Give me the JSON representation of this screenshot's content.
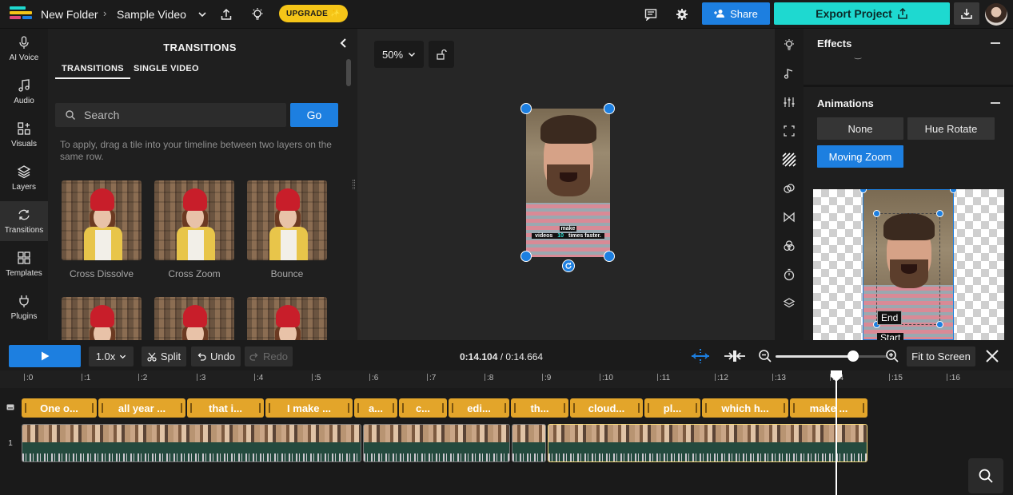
{
  "app": {
    "breadcrumb": [
      "New Folder",
      "Sample Video"
    ],
    "upgrade_label": "UPGRADE ✨",
    "share_label": "Share",
    "export_label": "Export Project",
    "accent": "#1d7fe0",
    "export_color": "#1ed9d0"
  },
  "rail": [
    {
      "label": "AI Voice",
      "icon": "mic-icon"
    },
    {
      "label": "Audio",
      "icon": "music-note-icon"
    },
    {
      "label": "Visuals",
      "icon": "grid-plus-icon"
    },
    {
      "label": "Layers",
      "icon": "layers-icon"
    },
    {
      "label": "Transitions",
      "icon": "transitions-icon",
      "active": true
    },
    {
      "label": "Templates",
      "icon": "templates-icon"
    },
    {
      "label": "Plugins",
      "icon": "plug-icon"
    }
  ],
  "transitions": {
    "title": "TRANSITIONS",
    "tabs": [
      "TRANSITIONS",
      "SINGLE VIDEO"
    ],
    "search_placeholder": "Search",
    "go_label": "Go",
    "hint": "To apply, drag a tile into your timeline between two layers on the same row.",
    "tiles": [
      "Cross Dissolve",
      "Cross Zoom",
      "Bounce",
      "",
      "",
      ""
    ]
  },
  "canvas": {
    "zoom": "50%",
    "caption_line1": "make",
    "caption_line2_pre": "videos ",
    "caption_highlight": "10",
    "caption_line2_post": " times faster."
  },
  "right_panel": {
    "effects_title": "Effects",
    "animations_title": "Animations",
    "animation_options": [
      "None",
      "Hue Rotate",
      "Moving Zoom"
    ],
    "selected_animation": "Moving Zoom",
    "end_label": "End",
    "start_label": "Start"
  },
  "transport": {
    "speed": "1.0x",
    "split_label": "Split",
    "undo_label": "Undo",
    "redo_label": "Redo",
    "current_time": "0:14.104",
    "total_time": "0:14.664",
    "fit_label": "Fit to Screen",
    "zoom_level_fraction": 0.69
  },
  "timeline": {
    "ruler_labels": [
      ":0",
      ":1",
      ":2",
      ":3",
      ":4",
      ":5",
      ":6",
      ":7",
      ":8",
      ":9",
      ":10",
      ":11",
      ":12",
      ":13",
      ":14",
      ":15",
      ":16"
    ],
    "row_1_label": "1",
    "subtitle_clips": [
      "One o...",
      "all year ...",
      "that i...",
      "I make ...",
      "a...",
      "c...",
      "edi...",
      "th...",
      "cloud...",
      "pl...",
      "which h...",
      "make ..."
    ]
  }
}
